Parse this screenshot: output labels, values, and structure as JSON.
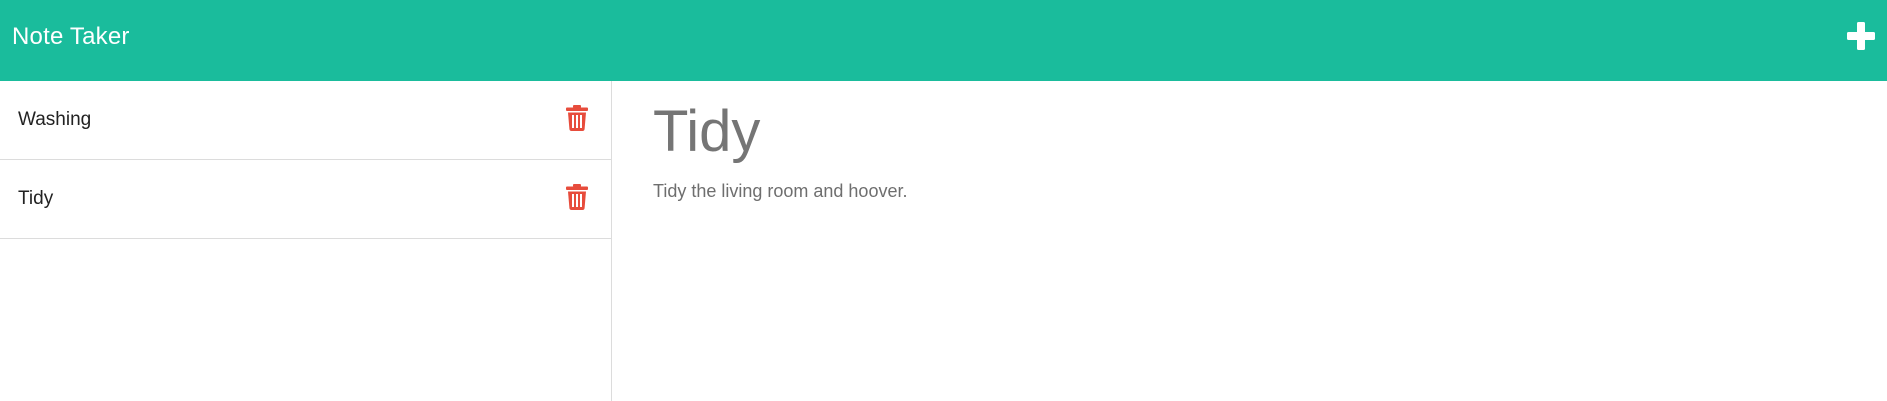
{
  "header": {
    "title": "Note Taker",
    "add_icon": "plus-icon"
  },
  "sidebar": {
    "items": [
      {
        "label": "Washing",
        "delete_icon": "trash-icon"
      },
      {
        "label": "Tidy",
        "delete_icon": "trash-icon"
      }
    ]
  },
  "note": {
    "title": "Tidy",
    "text": "Tidy the living room and hoover."
  },
  "colors": {
    "navbar": "#1abc9c",
    "delete": "#e74c3c",
    "note_text": "#757575"
  }
}
